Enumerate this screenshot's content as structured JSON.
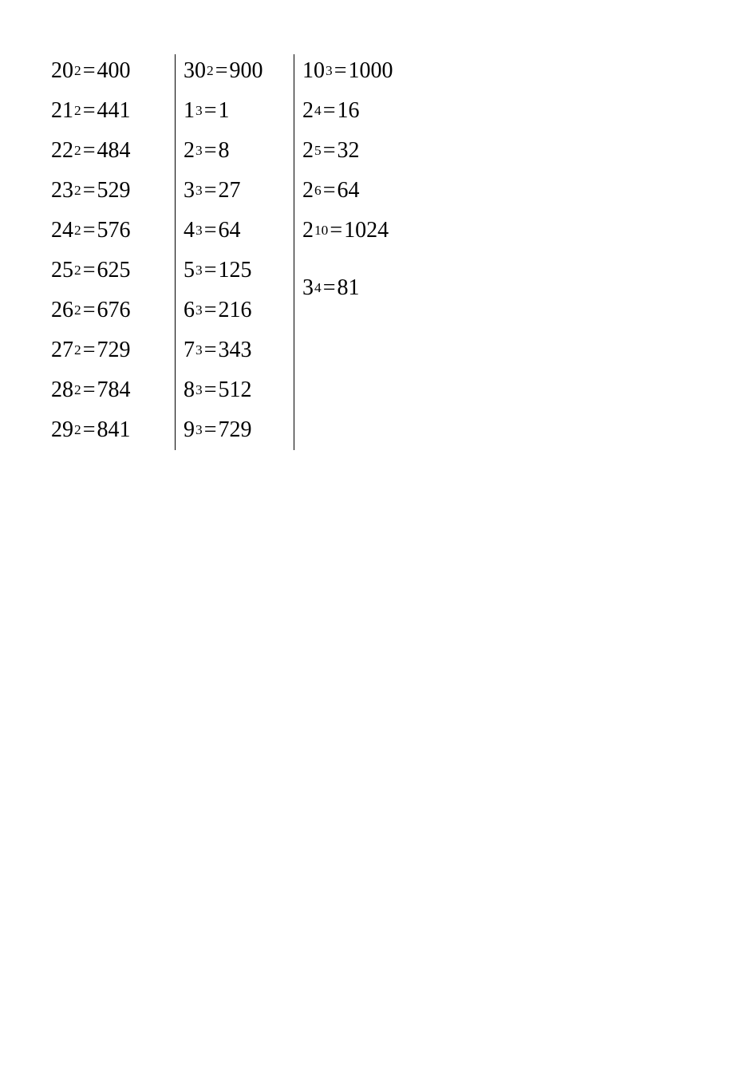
{
  "columns": [
    [
      {
        "base": "20",
        "exp": "2",
        "result": "400"
      },
      {
        "base": "21",
        "exp": "2",
        "result": "441"
      },
      {
        "base": "22",
        "exp": "2",
        "result": "484"
      },
      {
        "base": "23",
        "exp": "2",
        "result": "529"
      },
      {
        "base": "24",
        "exp": "2",
        "result": "576"
      },
      {
        "base": "25",
        "exp": "2",
        "result": "625"
      },
      {
        "base": "26",
        "exp": "2",
        "result": "676"
      },
      {
        "base": "27",
        "exp": "2",
        "result": "729"
      },
      {
        "base": "28",
        "exp": "2",
        "result": "784"
      },
      {
        "base": "29",
        "exp": "2",
        "result": "841"
      }
    ],
    [
      {
        "base": "30",
        "exp": "2",
        "result": "900"
      },
      {
        "base": "1",
        "exp": "3",
        "result": "1"
      },
      {
        "base": "2",
        "exp": "3",
        "result": "8"
      },
      {
        "base": "3",
        "exp": "3",
        "result": "27"
      },
      {
        "base": "4",
        "exp": "3",
        "result": "64"
      },
      {
        "base": "5",
        "exp": "3",
        "result": "125"
      },
      {
        "base": "6",
        "exp": "3",
        "result": "216"
      },
      {
        "base": "7",
        "exp": "3",
        "result": "343"
      },
      {
        "base": "8",
        "exp": "3",
        "result": "512"
      },
      {
        "base": "9",
        "exp": "3",
        "result": "729"
      }
    ],
    [
      {
        "base": "10",
        "exp": "3",
        "result": "1000"
      },
      {
        "base": "2",
        "exp": "4",
        "result": "16"
      },
      {
        "base": "2",
        "exp": "5",
        "result": "32"
      },
      {
        "base": "2",
        "exp": "6",
        "result": "64"
      },
      {
        "base": "2",
        "exp": "10",
        "result": "1024"
      },
      {
        "base": "3",
        "exp": "4",
        "result": "81",
        "gap": true
      }
    ]
  ],
  "equals": "=",
  "chart_data": {
    "type": "table",
    "title": "",
    "columns": [
      [
        {
          "expression": "20^2",
          "value": 400
        },
        {
          "expression": "21^2",
          "value": 441
        },
        {
          "expression": "22^2",
          "value": 484
        },
        {
          "expression": "23^2",
          "value": 529
        },
        {
          "expression": "24^2",
          "value": 576
        },
        {
          "expression": "25^2",
          "value": 625
        },
        {
          "expression": "26^2",
          "value": 676
        },
        {
          "expression": "27^2",
          "value": 729
        },
        {
          "expression": "28^2",
          "value": 784
        },
        {
          "expression": "29^2",
          "value": 841
        }
      ],
      [
        {
          "expression": "30^2",
          "value": 900
        },
        {
          "expression": "1^3",
          "value": 1
        },
        {
          "expression": "2^3",
          "value": 8
        },
        {
          "expression": "3^3",
          "value": 27
        },
        {
          "expression": "4^3",
          "value": 64
        },
        {
          "expression": "5^3",
          "value": 125
        },
        {
          "expression": "6^3",
          "value": 216
        },
        {
          "expression": "7^3",
          "value": 343
        },
        {
          "expression": "8^3",
          "value": 512
        },
        {
          "expression": "9^3",
          "value": 729
        }
      ],
      [
        {
          "expression": "10^3",
          "value": 1000
        },
        {
          "expression": "2^4",
          "value": 16
        },
        {
          "expression": "2^5",
          "value": 32
        },
        {
          "expression": "2^6",
          "value": 64
        },
        {
          "expression": "2^10",
          "value": 1024
        },
        {
          "expression": "3^4",
          "value": 81
        }
      ]
    ]
  }
}
